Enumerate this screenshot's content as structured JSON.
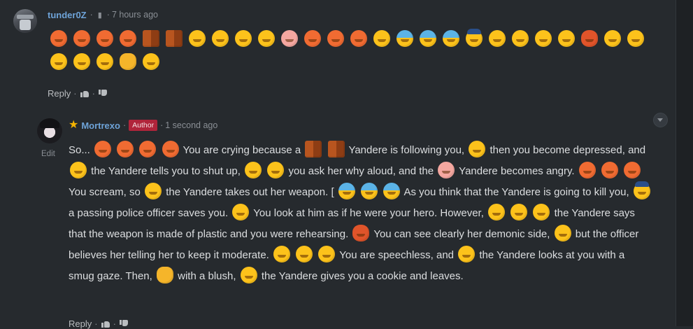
{
  "comments": [
    {
      "username": "tunder0Z",
      "separator": "·",
      "time": "7 hours ago",
      "emojis": [
        "tears-of-joy",
        "tears-of-joy",
        "tears-of-joy",
        "tears-of-joy",
        "brick-wall-runner",
        "brick-wall-runner",
        "frowning",
        "shushing",
        "thinking",
        "thinking",
        "angry-face",
        "tears-of-joy",
        "tears-of-joy",
        "tears-of-joy",
        "sunglasses-knife",
        "fearful",
        "fearful",
        "fearful",
        "police-officer",
        "hugging-star",
        "squinting",
        "squinting",
        "squinting",
        "devil",
        "winking-tongue",
        "zipper-mouth",
        "zipper-mouth",
        "zipper-mouth",
        "smirking",
        "blushing-cat",
        "cookie-face"
      ],
      "actions": {
        "reply": "Reply",
        "like_icon": "thumbs-up-icon",
        "dislike_icon": "thumbs-down-icon"
      }
    },
    {
      "username": "Mortrexo",
      "badge": "Author",
      "separator": "·",
      "time": "1 second ago",
      "edit_label": "Edit",
      "text": [
        "So...",
        "You are crying because a",
        "Yandere is following you,",
        "then you become depressed, and",
        "the Yandere tells you to shut up,",
        "you ask her why aloud, and the",
        "Yandere becomes angry.",
        "You scream, so",
        "the Yandere takes out her weapon. [",
        "As you think that the Yandere is going to kill you,",
        "a passing police officer saves you.",
        "You look at him as if he were your hero. However,",
        "the Yandere says that the weapon is made of plastic and you were rehearsing.",
        "You can see clearly her demonic side,",
        "but the officer believes her telling her to keep it moderate.",
        "You are speechless, and",
        "the Yandere looks at you with a smug gaze. Then,",
        "with a blush,",
        "the Yandere gives you a cookie and leaves."
      ],
      "actions": {
        "reply": "Reply",
        "like_icon": "thumbs-up-icon",
        "dislike_icon": "thumbs-down-icon"
      }
    }
  ],
  "icons": {
    "pin": "pin-icon",
    "star": "star-icon",
    "collapse": "chevron-down-icon"
  },
  "colors": {
    "background": "#262a2e",
    "username": "#6ea3d8",
    "author_badge": "#b0243a",
    "star": "#f5b400"
  }
}
